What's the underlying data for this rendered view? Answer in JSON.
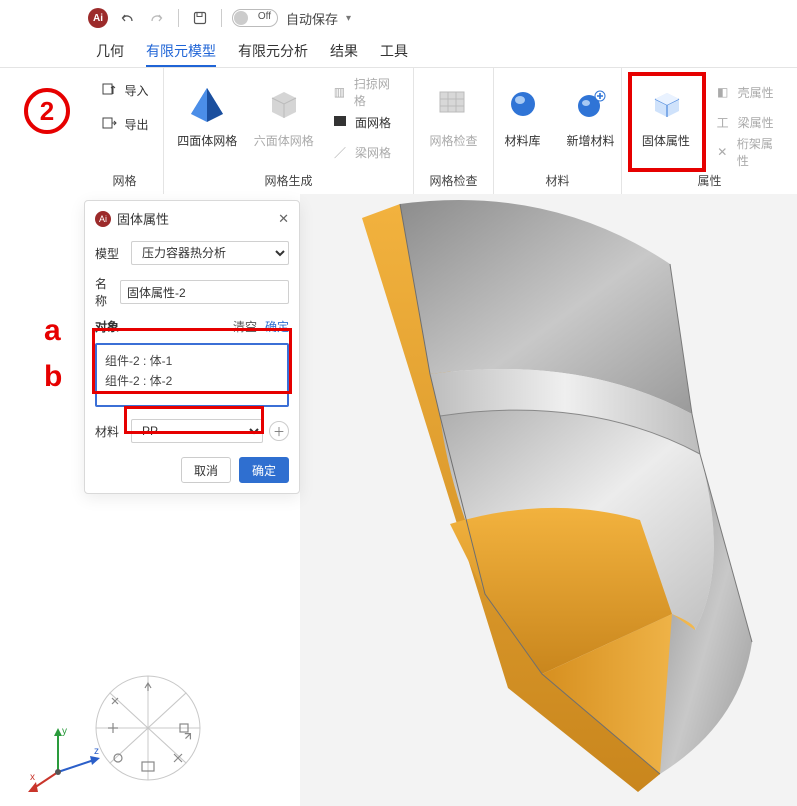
{
  "qat": {
    "toggle_label": "Off",
    "autosave": "自动保存"
  },
  "tabs": {
    "geometry": "几何",
    "fe_model": "有限元模型",
    "fe_analysis": "有限元分析",
    "results": "结果",
    "tools": "工具"
  },
  "ribbon": {
    "mesh_group": {
      "import": "导入",
      "export": "导出",
      "title": "网格"
    },
    "meshgen_group": {
      "tet": "四面体网格",
      "hex": "六面体网格",
      "sweep": "扫掠网格",
      "surface": "面网格",
      "beam": "梁网格",
      "title": "网格生成"
    },
    "meshcheck_group": {
      "check": "网格检查",
      "title": "网格检查"
    },
    "material_group": {
      "library": "材料库",
      "new": "新增材料",
      "title": "材料"
    },
    "property_group": {
      "solid": "固体属性",
      "shell": "壳属性",
      "beam": "梁属性",
      "truss": "桁架属性",
      "title": "属性"
    }
  },
  "annotations": {
    "step": "2",
    "a": "a",
    "b": "b"
  },
  "panel": {
    "title": "固体属性",
    "model_label": "模型",
    "model_value": "压力容器热分析",
    "name_label": "名称",
    "name_value": "固体属性-2",
    "object_label": "对象",
    "clear": "清空",
    "confirm_small": "确定",
    "items": [
      "组件-2 : 体-1",
      "组件-2 : 体-2"
    ],
    "material_label": "材料",
    "material_value": "PP",
    "cancel": "取消",
    "ok": "确定"
  },
  "axes": {
    "x": "x",
    "y": "y",
    "z": "z"
  }
}
